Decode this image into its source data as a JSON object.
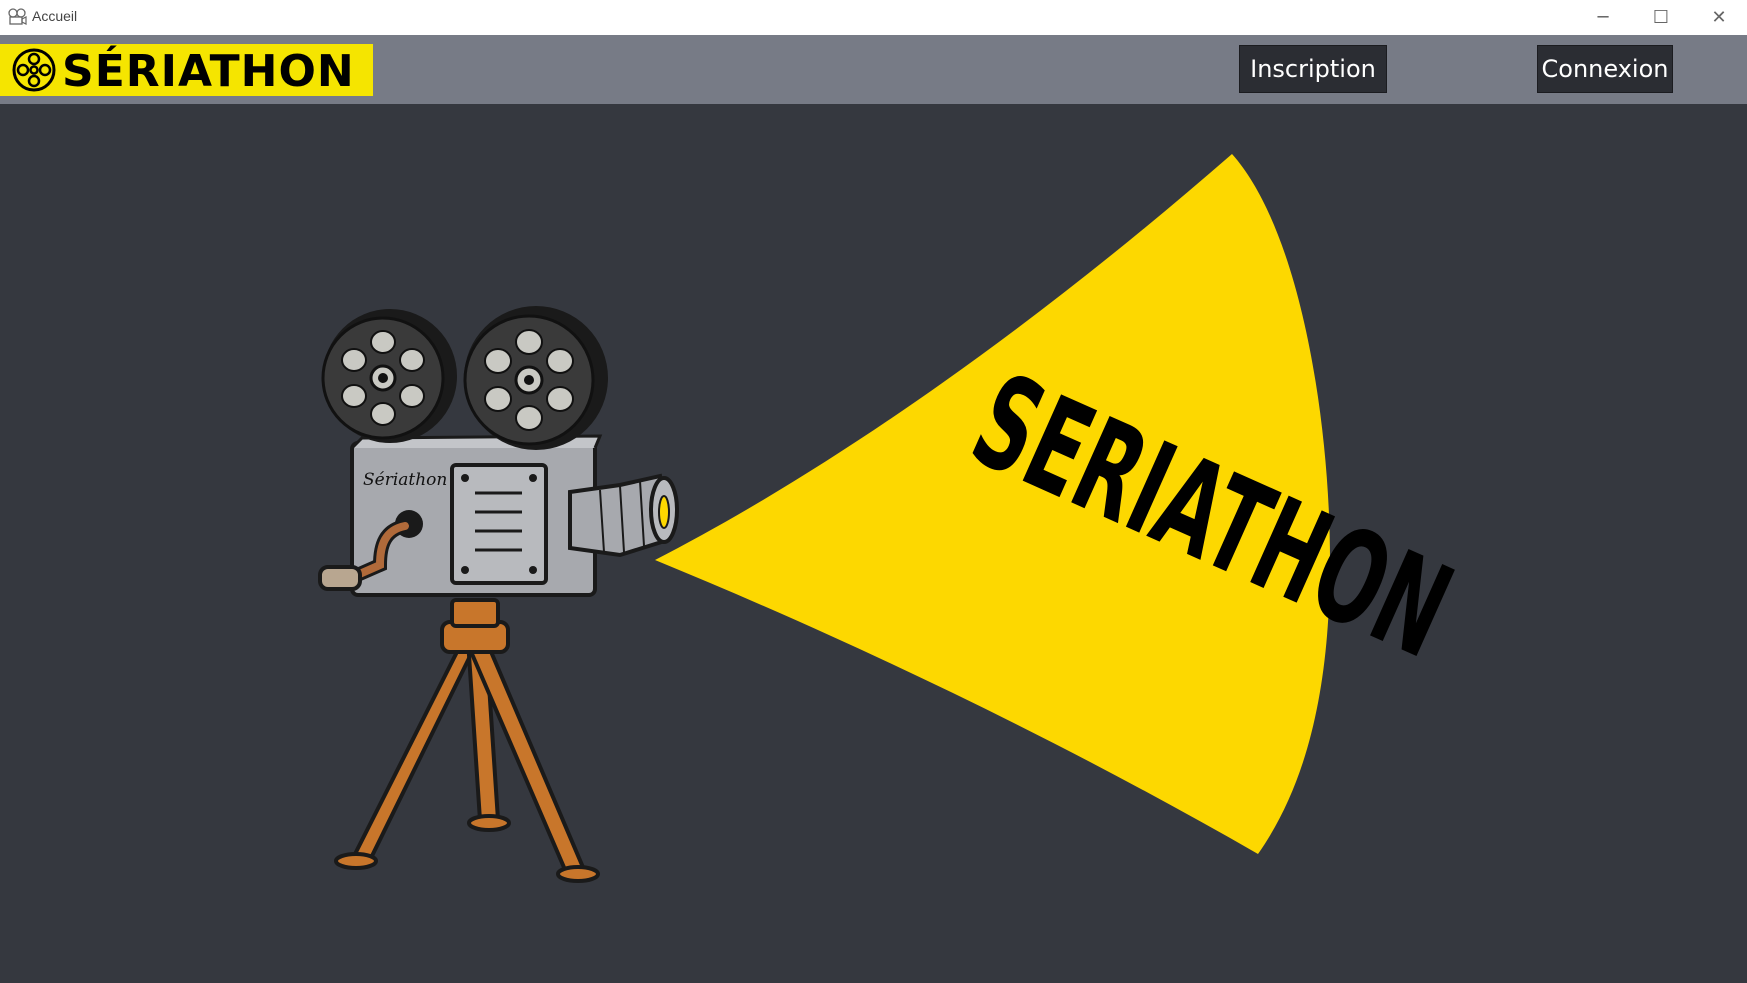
{
  "window": {
    "title": "Accueil",
    "icon": "app-icon",
    "controls": {
      "minimize": "─",
      "maximize": "☐",
      "close": "✕"
    }
  },
  "header": {
    "logo_text": "SÉRIATHON",
    "logo_icon": "film-reel-icon",
    "buttons": {
      "inscription": "Inscription",
      "connexion": "Connexion"
    }
  },
  "hero": {
    "beam_text": "SERIATHON",
    "camera_label": "Sériathon"
  },
  "colors": {
    "background": "#35383f",
    "header": "#777b86",
    "logo_bg": "#f5e500",
    "beam": "#fdd800",
    "button_bg": "#2b2d33",
    "camera_body": "#a7a9ae",
    "tripod": "#c8762b"
  }
}
